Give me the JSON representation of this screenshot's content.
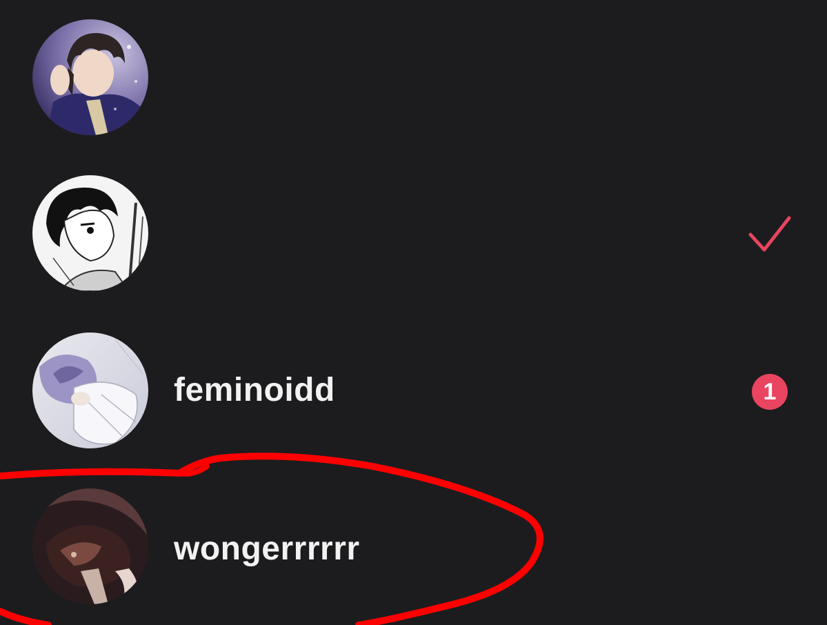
{
  "chat_list": {
    "items": [
      {
        "username": "",
        "avatar_icon": "avatar-anime-boy-icon",
        "status": "none"
      },
      {
        "username": "",
        "avatar_icon": "avatar-manga-sketch-icon",
        "status": "read-check",
        "status_icon": "checkmark-icon"
      },
      {
        "username": "feminoidd",
        "avatar_icon": "avatar-pale-illustration-icon",
        "status": "unread",
        "unread_count": "1"
      },
      {
        "username": "wongerrrrrr",
        "avatar_icon": "avatar-dark-illustration-icon",
        "status": "none"
      }
    ]
  },
  "colors": {
    "background": "#1c1c1e",
    "accent": "#e94560",
    "annotation": "#ff0000"
  }
}
